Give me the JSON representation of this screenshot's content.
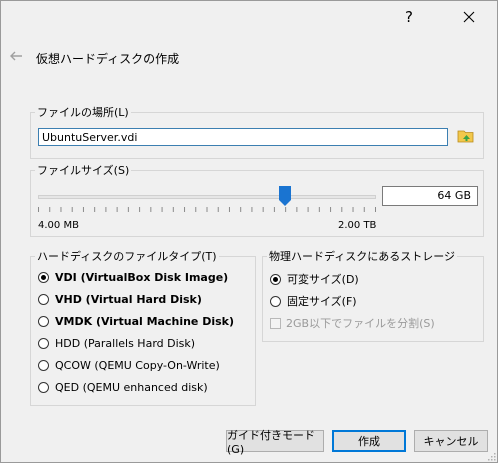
{
  "titlebar": {
    "help_glyph": "?",
    "close_icon": "close-icon"
  },
  "header": {
    "back_icon": "back-arrow-icon",
    "title": "仮想ハードディスクの作成"
  },
  "file_location": {
    "group_label": "ファイルの場所(L)",
    "value": "UbuntuServer.vdi",
    "folder_icon": "folder-browse-icon"
  },
  "file_size": {
    "group_label": "ファイルサイズ(S)",
    "value": "64 GB",
    "min_label": "4.00 MB",
    "max_label": "2.00 TB",
    "slider_position_fraction": 0.73
  },
  "disk_type": {
    "group_label": "ハードディスクのファイルタイプ(T)",
    "options": [
      {
        "label": "VDI (VirtualBox Disk Image)",
        "selected": true,
        "bold": true
      },
      {
        "label": "VHD (Virtual Hard Disk)",
        "selected": false,
        "bold": true
      },
      {
        "label": "VMDK (Virtual Machine Disk)",
        "selected": false,
        "bold": true
      },
      {
        "label": "HDD (Parallels Hard Disk)",
        "selected": false,
        "bold": false
      },
      {
        "label": "QCOW (QEMU Copy-On-Write)",
        "selected": false,
        "bold": false
      },
      {
        "label": "QED (QEMU enhanced disk)",
        "selected": false,
        "bold": false
      }
    ]
  },
  "storage": {
    "group_label": "物理ハードディスクにあるストレージ",
    "dynamic_label": "可変サイズ(D)",
    "fixed_label": "固定サイズ(F)",
    "split_label": "2GB以下でファイルを分割(S)",
    "dynamic_selected": true
  },
  "buttons": {
    "guided": "ガイド付きモード(G)",
    "create": "作成",
    "cancel": "キャンセル"
  },
  "colors": {
    "accent": "#0078d7",
    "slider_thumb": "#1a74d1",
    "folder": "#f2c84b"
  }
}
